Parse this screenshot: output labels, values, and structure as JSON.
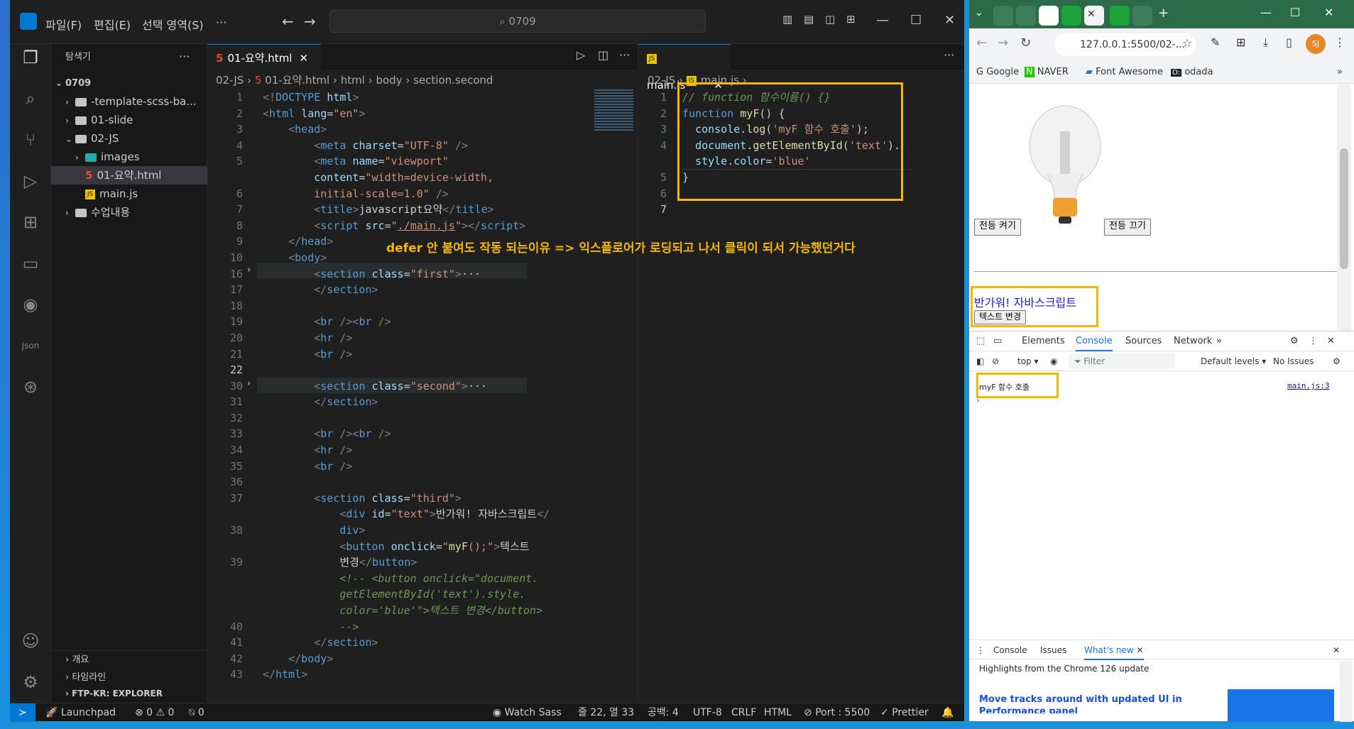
{
  "vscode": {
    "menu": [
      "파일(F)",
      "편집(E)",
      "선택 영역(S)",
      "···"
    ],
    "search": "0709",
    "sidebar": {
      "title": "탐색기",
      "root": "0709",
      "items": [
        {
          "label": "-template-scss-ba...",
          "type": "folder",
          "expanded": false
        },
        {
          "label": "01-slide",
          "type": "folder",
          "expanded": false
        },
        {
          "label": "02-JS",
          "type": "folder",
          "expanded": true
        },
        {
          "label": "images",
          "type": "image-folder",
          "expanded": false
        },
        {
          "label": "01-요약.html",
          "type": "html",
          "selected": true
        },
        {
          "label": "main.js",
          "type": "js"
        },
        {
          "label": "수업내용",
          "type": "folder",
          "expanded": false
        }
      ],
      "sections": [
        "개요",
        "타임라인",
        "FTP-KR: EXPLORER"
      ]
    },
    "left_editor": {
      "tab": "01-요약.html",
      "breadcrumb": [
        "02-JS",
        "01-요약.html",
        "html",
        "body",
        "section.second"
      ],
      "line_numbers": [
        "1",
        "2",
        "3",
        "4",
        "5",
        "",
        "6",
        "7",
        "8",
        "9",
        "10",
        "16",
        "17",
        "18",
        "19",
        "20",
        "21",
        "22",
        "30",
        "31",
        "32",
        "33",
        "34",
        "35",
        "36",
        "37",
        "",
        "38",
        "",
        "39",
        "",
        "",
        "",
        "40",
        "41",
        "42",
        "43"
      ]
    },
    "right_editor": {
      "tab": "main.js",
      "breadcrumb": [
        "02-JS",
        "main.js",
        "..."
      ],
      "line_numbers": [
        "1",
        "2",
        "3",
        "4",
        "",
        "5",
        "6",
        "7"
      ]
    },
    "annotation": "defer 안 붙여도 작동 되는이유 => 익스플로어가 로딩되고 나서 클릭이 되서 가능했던거다",
    "statusbar": {
      "launchpad": "Launchpad",
      "problems": "⊗ 0 ⚠ 0",
      "ports": "⍉ 0",
      "watch_sass": "Watch Sass",
      "position": "줄 22, 열 33",
      "spaces": "공백: 4",
      "encoding": "UTF-8",
      "eol": "CRLF",
      "language": "HTML",
      "port": "Port : 5500",
      "prettier": "Prettier"
    }
  },
  "chrome": {
    "url": "127.0.0.1:5500/02-...",
    "bookmarks": [
      "Google",
      "NAVER",
      "Font Awesome",
      "odada"
    ],
    "avatar": "SJ",
    "page": {
      "btn_on": "전등 켜기",
      "btn_off": "전등 끄기",
      "text": "반가워! 자바스크립트",
      "btn_change": "텍스트 변경"
    },
    "devtools": {
      "tabs": [
        "Elements",
        "Console",
        "Sources",
        "Network"
      ],
      "active_tab": "Console",
      "context": "top",
      "filter_placeholder": "Filter",
      "levels": "Default levels",
      "issues": "No Issues",
      "log_message": "myF 함수 호출",
      "log_source": "main.js:3",
      "drawer_tabs": [
        "Console",
        "Issues",
        "What's new"
      ],
      "drawer_active": "What's new",
      "whatsnew_header": "Highlights from the Chrome 126 update",
      "whatsnew_title": "Move tracks around with updated UI in Performance panel"
    }
  },
  "colors": {
    "accent": "#0078d4",
    "annotation": "#f5b800",
    "chrome_frame": "#2b6b48"
  }
}
